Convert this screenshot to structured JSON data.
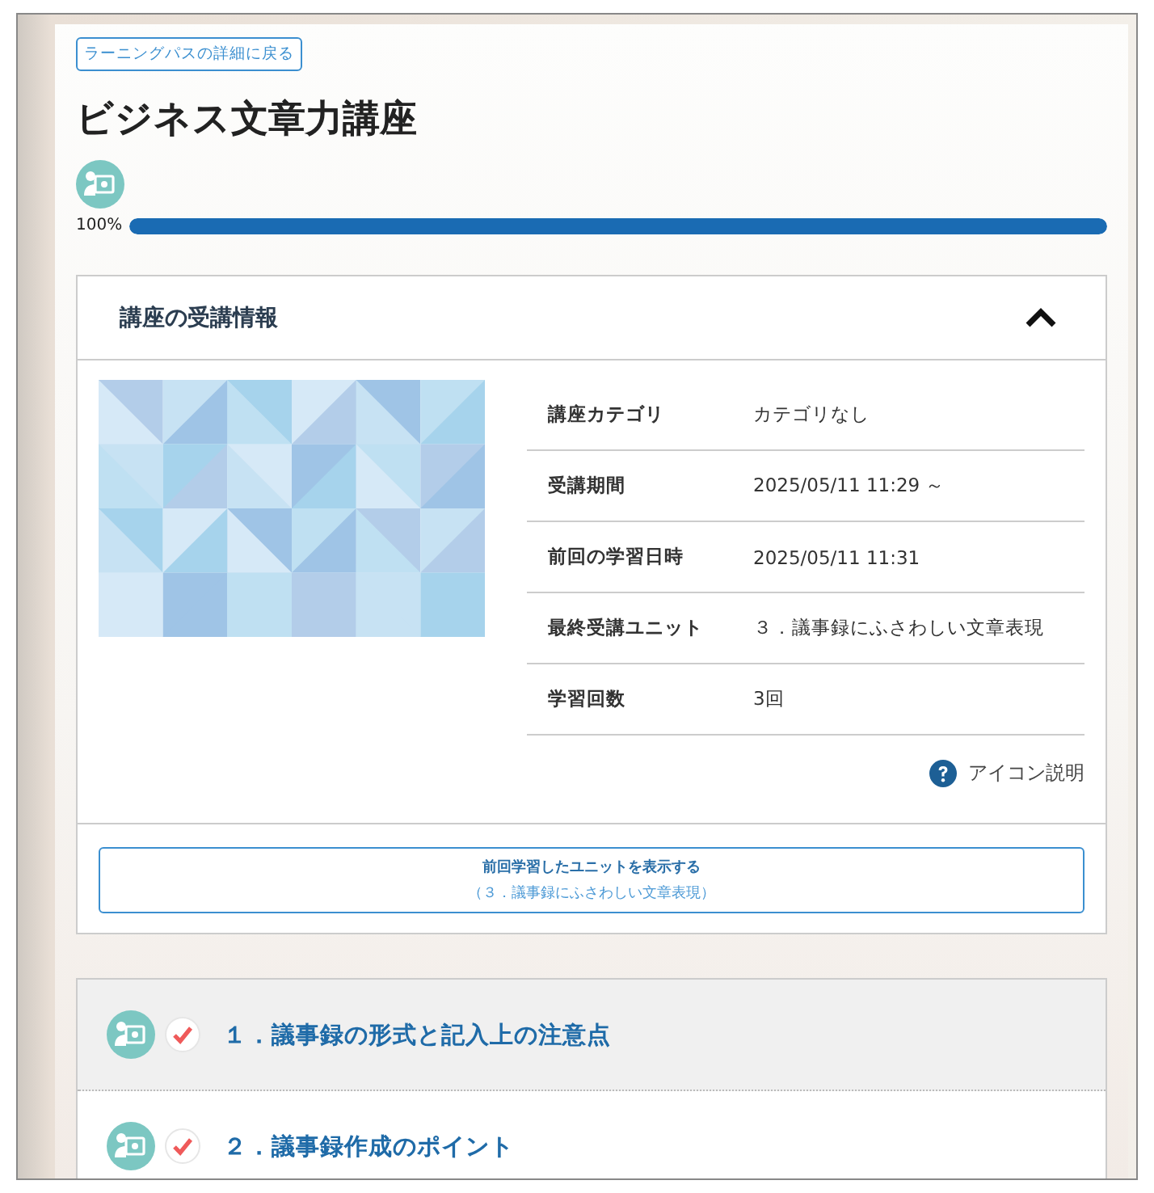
{
  "back_link": "ラーニングパスの詳細に戻る",
  "title": "ビジネス文章力講座",
  "progress": {
    "label": "100%",
    "level": 1
  },
  "info": {
    "title": "講座の受講情報",
    "expanded": true,
    "rows": [
      {
        "label": "講座カテゴリ",
        "value": "カテゴリなし"
      },
      {
        "label": "受講期間",
        "value": "2025/05/11 11:29 ～"
      },
      {
        "label": "前回の学習日時",
        "value": "2025/05/11 11:31"
      },
      {
        "label": "最終受講ユニット",
        "value": "３．議事録にふさわしい文章表現"
      },
      {
        "label": "学習回数",
        "value": "3回"
      }
    ],
    "icon_help": "アイコン説明",
    "resume_button": {
      "title": "前回学習したユニットを表示する",
      "subtitle": "（３．議事録にふさわしい文章表現）"
    }
  },
  "units": [
    {
      "title": "１．議事録の形式と記入上の注意点",
      "completed": true,
      "selected": true
    },
    {
      "title": "２．議事録作成のポイント",
      "completed": true,
      "selected": false
    }
  ]
}
